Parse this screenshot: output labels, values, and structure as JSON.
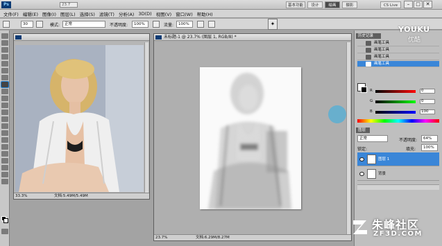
{
  "app": {
    "logo": "Ps",
    "zoom": "23.7",
    "workspaces": [
      "基本功能",
      "设计",
      "绘画",
      "摄影"
    ],
    "active_workspace": "绘画",
    "cs_live": "CS Live",
    "win_min": "–",
    "win_max": "□",
    "win_close": "✕"
  },
  "menu": [
    "文件(F)",
    "编辑(E)",
    "图像(I)",
    "图层(L)",
    "选择(S)",
    "滤镜(T)",
    "分析(A)",
    "3D(D)",
    "视图(V)",
    "窗口(W)",
    "帮助(H)"
  ],
  "options": {
    "size": "30",
    "mode_label": "模式:",
    "mode_value": "正常",
    "opacity_label": "不透明度:",
    "opacity_value": "100%",
    "flow_label": "流量:",
    "flow_value": "100%"
  },
  "doc1": {
    "title": "",
    "zoom": "33.3%",
    "doc_info": "文档:5.49M/5.49M"
  },
  "doc2": {
    "title": "未标题-1 @ 23.7% (图层 1, RGB/8) *",
    "zoom": "23.7%",
    "doc_info": "文档:6.29M/8.27M"
  },
  "history": {
    "title": "历史记录",
    "rows": [
      "画笔工具",
      "画笔工具",
      "画笔工具",
      "画笔工具"
    ]
  },
  "color": {
    "labels": [
      "R",
      "G",
      "B"
    ],
    "values": [
      "0",
      "0",
      "100"
    ]
  },
  "layers": {
    "title": "图层",
    "blend_mode": "正常",
    "opacity_label": "不透明度:",
    "opacity_value": "64%",
    "lock_label": "锁定:",
    "fill_label": "填充:",
    "fill_value": "100%",
    "rows": [
      {
        "name": "图层 1",
        "active": true
      },
      {
        "name": "背景",
        "active": false
      }
    ]
  },
  "watermarks": {
    "youku": "YOUKU",
    "youku_cn": "优酷",
    "zf_title": "朱峰社区",
    "zf_url": "ZF3D.COM"
  },
  "colors": {
    "accent": "#3a86d8",
    "ps_blue": "#0a3a73",
    "cursor": "#50afd7"
  }
}
